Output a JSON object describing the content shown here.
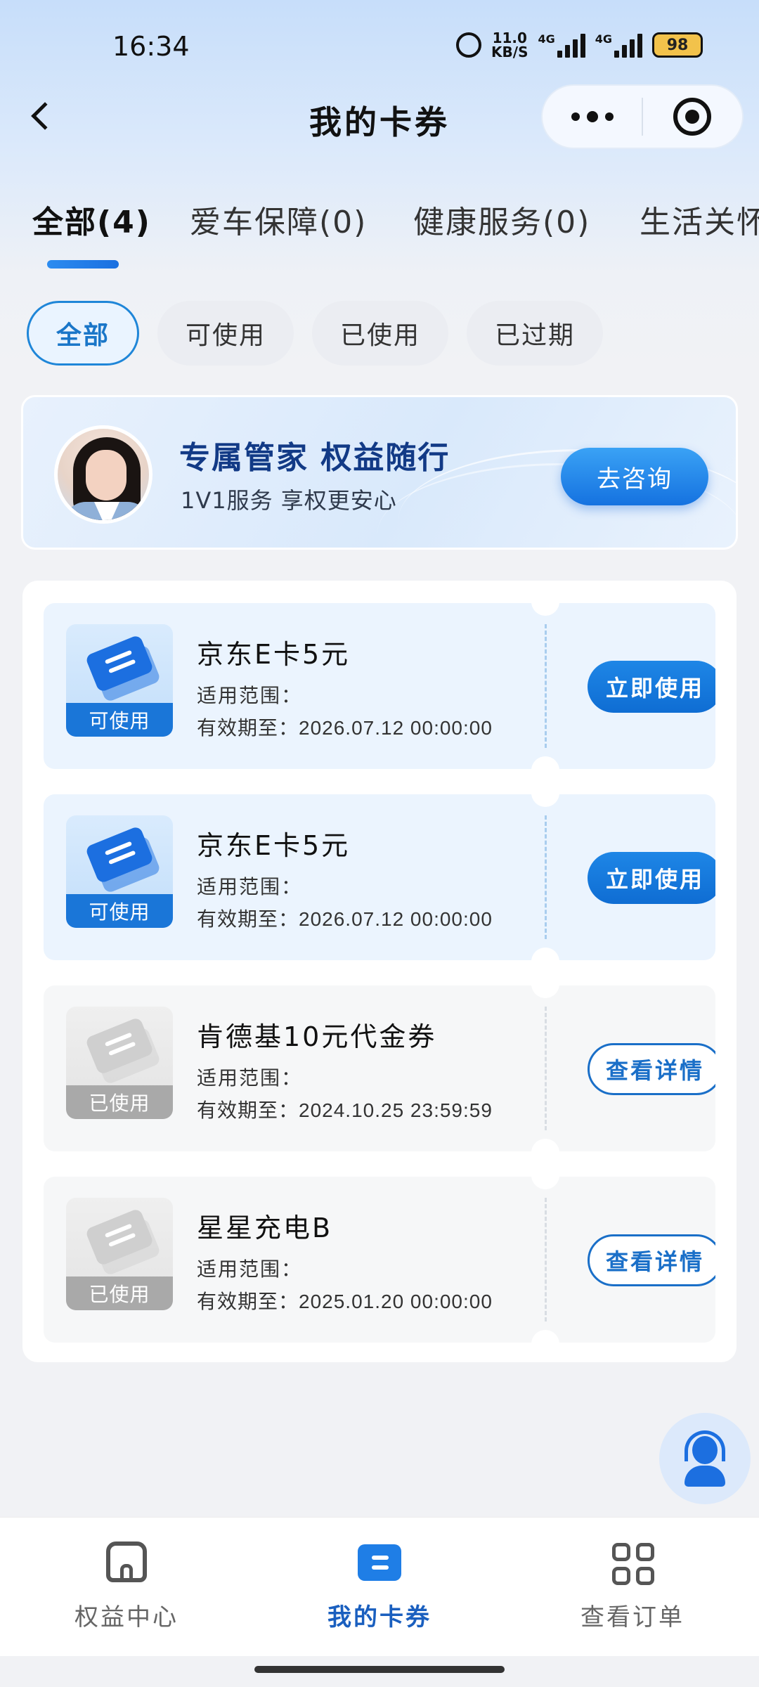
{
  "status_bar": {
    "time": "16:34",
    "net_speed_value": "11.0",
    "net_speed_unit": "KB/S",
    "network_1": "4G",
    "network_2": "4G",
    "battery": "98"
  },
  "header": {
    "title": "我的卡券"
  },
  "category_tabs": [
    {
      "label": "全部(4)",
      "active": true
    },
    {
      "label": "爱车保障(0)",
      "active": false
    },
    {
      "label": "健康服务(0)",
      "active": false
    },
    {
      "label": "生活关怀",
      "active": false
    }
  ],
  "filters": [
    {
      "label": "全部",
      "active": true
    },
    {
      "label": "可使用",
      "active": false
    },
    {
      "label": "已使用",
      "active": false
    },
    {
      "label": "已过期",
      "active": false
    }
  ],
  "banner": {
    "title": "专属管家 权益随行",
    "subtitle": "1V1服务 享权更安心",
    "button": "去咨询"
  },
  "coupons": [
    {
      "name": "京东E卡5元",
      "status": "可使用",
      "scope_label": "适用范围：",
      "valid_label": "有效期至：",
      "valid_until": "2026.07.12 00:00:00",
      "button": "立即使用"
    },
    {
      "name": "京东E卡5元",
      "status": "可使用",
      "scope_label": "适用范围：",
      "valid_label": "有效期至：",
      "valid_until": "2026.07.12 00:00:00",
      "button": "立即使用"
    },
    {
      "name": "肯德基10元代金券",
      "status": "已使用",
      "scope_label": "适用范围：",
      "valid_label": "有效期至：",
      "valid_until": "2024.10.25 23:59:59",
      "button": "查看详情"
    },
    {
      "name": "星星充电B",
      "status": "已使用",
      "scope_label": "适用范围：",
      "valid_label": "有效期至：",
      "valid_until": "2025.01.20 00:00:00",
      "button": "查看详情"
    }
  ],
  "bottom_nav": [
    {
      "label": "权益中心",
      "icon": "home-icon",
      "active": false
    },
    {
      "label": "我的卡券",
      "icon": "coupon-icon",
      "active": true
    },
    {
      "label": "查看订单",
      "icon": "grid-icon",
      "active": false
    }
  ],
  "colors": {
    "accent": "#1a76d8",
    "active_nav": "#1a5fbf",
    "used_gray": "#a9a9a9"
  }
}
